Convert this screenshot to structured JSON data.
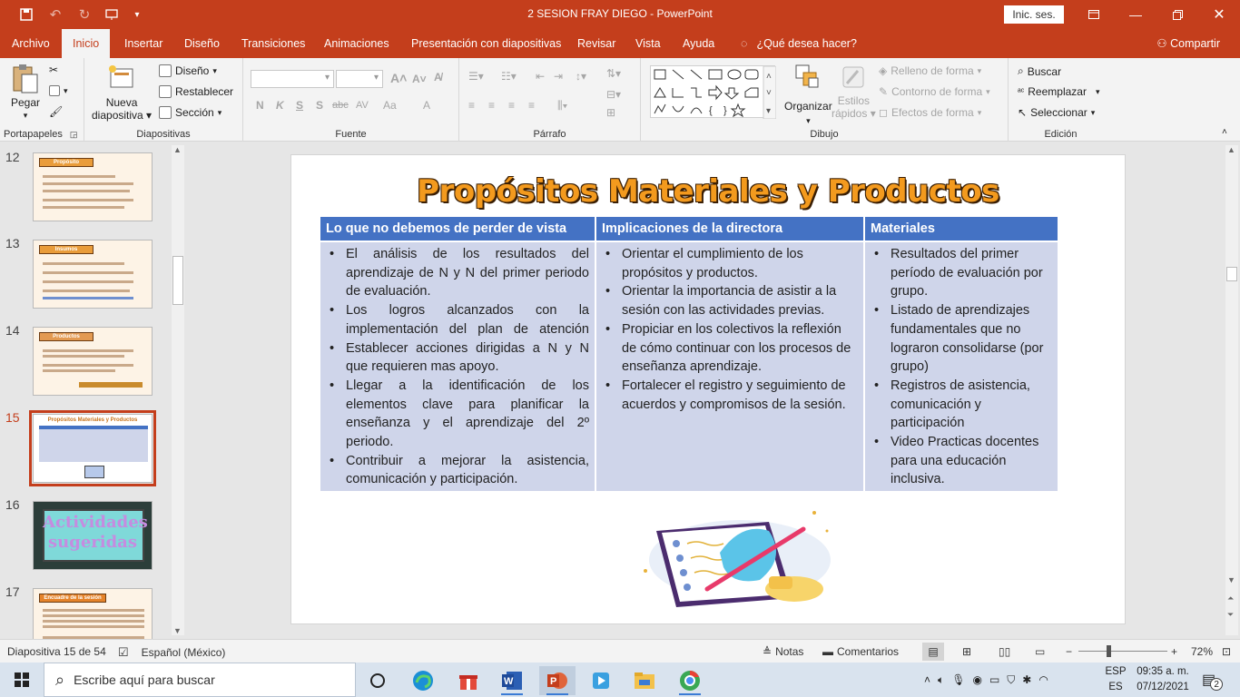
{
  "window": {
    "title": "2 SESION FRAY DIEGO  -  PowerPoint",
    "signin_label": "Inic. ses.",
    "colors": {
      "accent": "#c43e1c",
      "ribbon_bg": "#f3f3f3"
    }
  },
  "tabs": [
    {
      "label": "Archivo"
    },
    {
      "label": "Inicio",
      "active": true
    },
    {
      "label": "Insertar"
    },
    {
      "label": "Diseño"
    },
    {
      "label": "Transiciones"
    },
    {
      "label": "Animaciones"
    },
    {
      "label": "Presentación con diapositivas"
    },
    {
      "label": "Revisar"
    },
    {
      "label": "Vista"
    },
    {
      "label": "Ayuda"
    },
    {
      "label": "¿Qué desea hacer?"
    }
  ],
  "share_label": "Compartir",
  "ribbon": {
    "portapapeles": {
      "label": "Portapapeles",
      "paste": "Pegar"
    },
    "diapositivas": {
      "label": "Diapositivas",
      "new_slide_1": "Nueva",
      "new_slide_2": "diapositiva",
      "layout": "Diseño",
      "reset": "Restablecer",
      "section": "Sección"
    },
    "fuente": {
      "label": "Fuente",
      "bold": "N",
      "italic": "K",
      "underline": "S",
      "shadow": "S",
      "strike": "abc",
      "spacing": "AV",
      "case": "Aa",
      "color": "A"
    },
    "parrafo": {
      "label": "Párrafo"
    },
    "dibujo": {
      "label": "Dibujo",
      "arrange": "Organizar",
      "quick_styles_1": "Estilos",
      "quick_styles_2": "rápidos",
      "fill": "Relleno de forma",
      "outline": "Contorno de forma",
      "effects": "Efectos de forma"
    },
    "edicion": {
      "label": "Edición",
      "find": "Buscar",
      "replace": "Reemplazar",
      "select": "Seleccionar"
    }
  },
  "thumbnails": [
    {
      "num": "12",
      "title": "Propósito",
      "kind": "light"
    },
    {
      "num": "13",
      "title": "Insumos",
      "kind": "light"
    },
    {
      "num": "14",
      "title": "Productos",
      "kind": "light"
    },
    {
      "num": "15",
      "title": "Propósitos Materiales y Productos",
      "kind": "light",
      "selected": true
    },
    {
      "num": "16",
      "title": "Actividades sugeridas",
      "kind": "dark"
    },
    {
      "num": "17",
      "title": "Encuadre de la sesión",
      "kind": "light"
    }
  ],
  "slide": {
    "title": "Propósitos Materiales y Productos",
    "table": {
      "headers": [
        "Lo que no debemos de perder de vista",
        "Implicaciones  de la directora",
        "Materiales"
      ],
      "col1": [
        "El análisis de los resultados del aprendizaje de N y N del primer periodo de evaluación.",
        "Los logros alcanzados con la implementación del plan de atención",
        "Establecer acciones dirigidas a N y N que requieren mas apoyo.",
        "Llegar a la identificación de los elementos clave para planificar la enseñanza y el aprendizaje del 2º periodo.",
        "Contribuir a mejorar la asistencia, comunicación y participación."
      ],
      "col2": [
        "Orientar el cumplimiento de los propósitos y productos.",
        "Orientar la importancia de asistir a la sesión con las actividades previas.",
        "Propiciar en los colectivos la reflexión de cómo continuar con los procesos de enseñanza aprendizaje.",
        "Fortalecer el registro y seguimiento de  acuerdos y compromisos de la sesión."
      ],
      "col3": [
        "Resultados del primer período de evaluación por grupo.",
        "Listado de aprendizajes fundamentales que no lograron consolidarse (por grupo)",
        "Registros de asistencia, comunicación y participación",
        "Video Practicas docentes para una educación inclusiva."
      ]
    }
  },
  "status": {
    "slide_info": "Diapositiva 15 de 54",
    "language": "Español (México)",
    "notes": "Notas",
    "comments": "Comentarios",
    "zoom": "72%"
  },
  "taskbar": {
    "search_placeholder": "Escribe aquí para buscar",
    "lang_1": "ESP",
    "lang_2": "ES",
    "time": "09:35 a. m.",
    "date": "07/12/2021",
    "notif_count": "2"
  }
}
